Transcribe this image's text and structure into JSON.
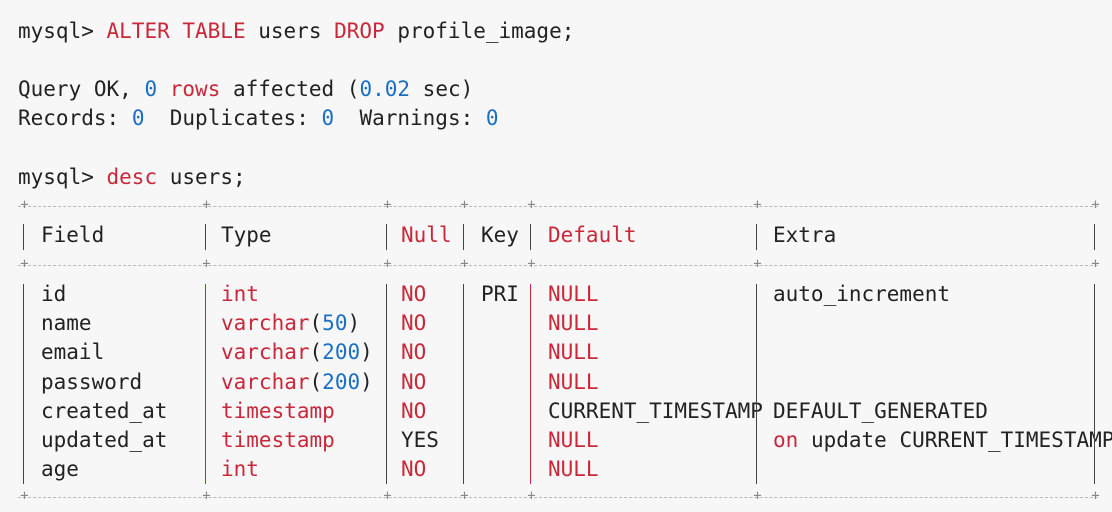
{
  "terminal": {
    "cmd1": {
      "prompt": "mysql>",
      "kw1": "ALTER TABLE",
      "t1": "users",
      "kw2": "DROP",
      "t2": "profile_image;"
    },
    "result": {
      "query_ok": "Query OK,",
      "rows_count": "0",
      "rows_word": "rows",
      "affected": "affected (",
      "time": "0.02",
      "sec": "sec)",
      "records_label": "Records:",
      "records_val": "0",
      "duplicates_label": "Duplicates:",
      "duplicates_val": "0",
      "warnings_label": "Warnings:",
      "warnings_val": "0"
    },
    "cmd2": {
      "prompt": "mysql>",
      "kw": "desc",
      "t": "users;"
    }
  },
  "table": {
    "headers": [
      "Field",
      "Type",
      "Null",
      "Key",
      "Default",
      "Extra"
    ],
    "rows": [
      {
        "field": "id",
        "type_base": "int",
        "type_len": "",
        "null": "NO",
        "key": "PRI",
        "default": "NULL",
        "extra": "auto_increment",
        "extra_kw": ""
      },
      {
        "field": "name",
        "type_base": "varchar",
        "type_len": "50",
        "null": "NO",
        "key": "",
        "default": "NULL",
        "extra": "",
        "extra_kw": ""
      },
      {
        "field": "email",
        "type_base": "varchar",
        "type_len": "200",
        "null": "NO",
        "key": "",
        "default": "NULL",
        "extra": "",
        "extra_kw": ""
      },
      {
        "field": "password",
        "type_base": "varchar",
        "type_len": "200",
        "null": "NO",
        "key": "",
        "default": "NULL",
        "extra": "",
        "extra_kw": ""
      },
      {
        "field": "created_at",
        "type_base": "timestamp",
        "type_len": "",
        "null": "NO",
        "key": "",
        "default": "CURRENT_TIMESTAMP",
        "extra": "DEFAULT_GENERATED",
        "extra_kw": ""
      },
      {
        "field": "updated_at",
        "type_base": "timestamp",
        "type_len": "",
        "null": "YES",
        "key": "",
        "default": "NULL",
        "extra": "update CURRENT_TIMESTAMP",
        "extra_kw": "on"
      },
      {
        "field": "age",
        "type_base": "int",
        "type_len": "",
        "null": "NO",
        "key": "",
        "default": "NULL",
        "extra": "",
        "extra_kw": ""
      }
    ]
  },
  "colors": {
    "keyword": "#c8283a",
    "number": "#1a6fc4",
    "text": "#222222",
    "background": "#f7f7f7"
  }
}
